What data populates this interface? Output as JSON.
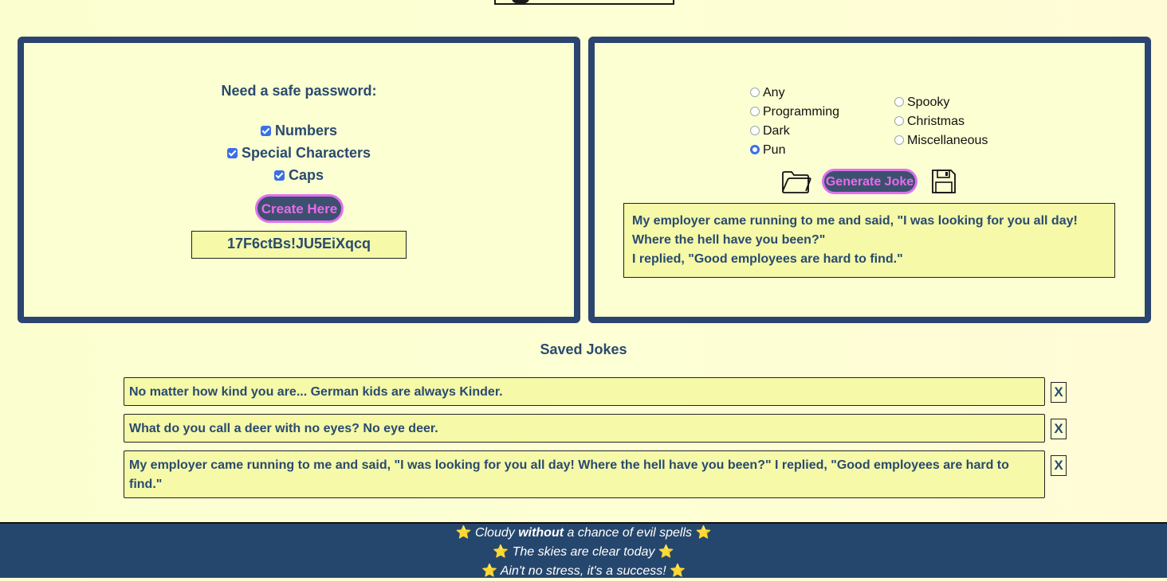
{
  "password": {
    "title": "Need a safe password:",
    "options": [
      {
        "label": "Numbers",
        "checked": true
      },
      {
        "label": "Special Characters",
        "checked": true
      },
      {
        "label": "Caps",
        "checked": true
      }
    ],
    "create_label": "Create Here",
    "result": "17F6ctBs!JU5EiXqcq"
  },
  "jokes": {
    "categories": [
      {
        "label": "Any",
        "selected": false
      },
      {
        "label": "Programming",
        "selected": false
      },
      {
        "label": "Dark",
        "selected": false
      },
      {
        "label": "Pun",
        "selected": true
      },
      {
        "label": "Spooky",
        "selected": false
      },
      {
        "label": "Christmas",
        "selected": false
      },
      {
        "label": "Miscellaneous",
        "selected": false
      }
    ],
    "generate_label": "Generate Joke",
    "open_icon": "folder-icon",
    "save_icon": "floppy-disk-icon",
    "current_joke": {
      "line1": "My employer came running to me and said, \"I was looking for you all day!",
      "line2": "Where the hell have you been?\"",
      "line3": "I replied, \"Good employees are hard to find.\""
    }
  },
  "saved": {
    "title": "Saved Jokes",
    "items": [
      "No matter how kind you are... German kids are always Kinder.",
      "What do you call a deer with no eyes? No eye deer.",
      "My employer came running to me and said, \"I was looking for you all day! Where the hell have you been?\" I replied, \"Good employees are hard to find.\""
    ],
    "delete_label": "X"
  },
  "footer": {
    "star": "⭐",
    "line1_pre": "Cloudy ",
    "line1_bold": "without",
    "line1_post": " a chance of evil spells",
    "line2": "The skies are clear today",
    "line3": "Ain't no stress, it's a success!"
  },
  "colors": {
    "panel_border": "#2c4470",
    "text": "#2a4a6f",
    "button_bg": "#3d5070",
    "button_text": "#e86be8",
    "output_bg": "#f5f9a8",
    "footer_bg": "#26476d"
  }
}
